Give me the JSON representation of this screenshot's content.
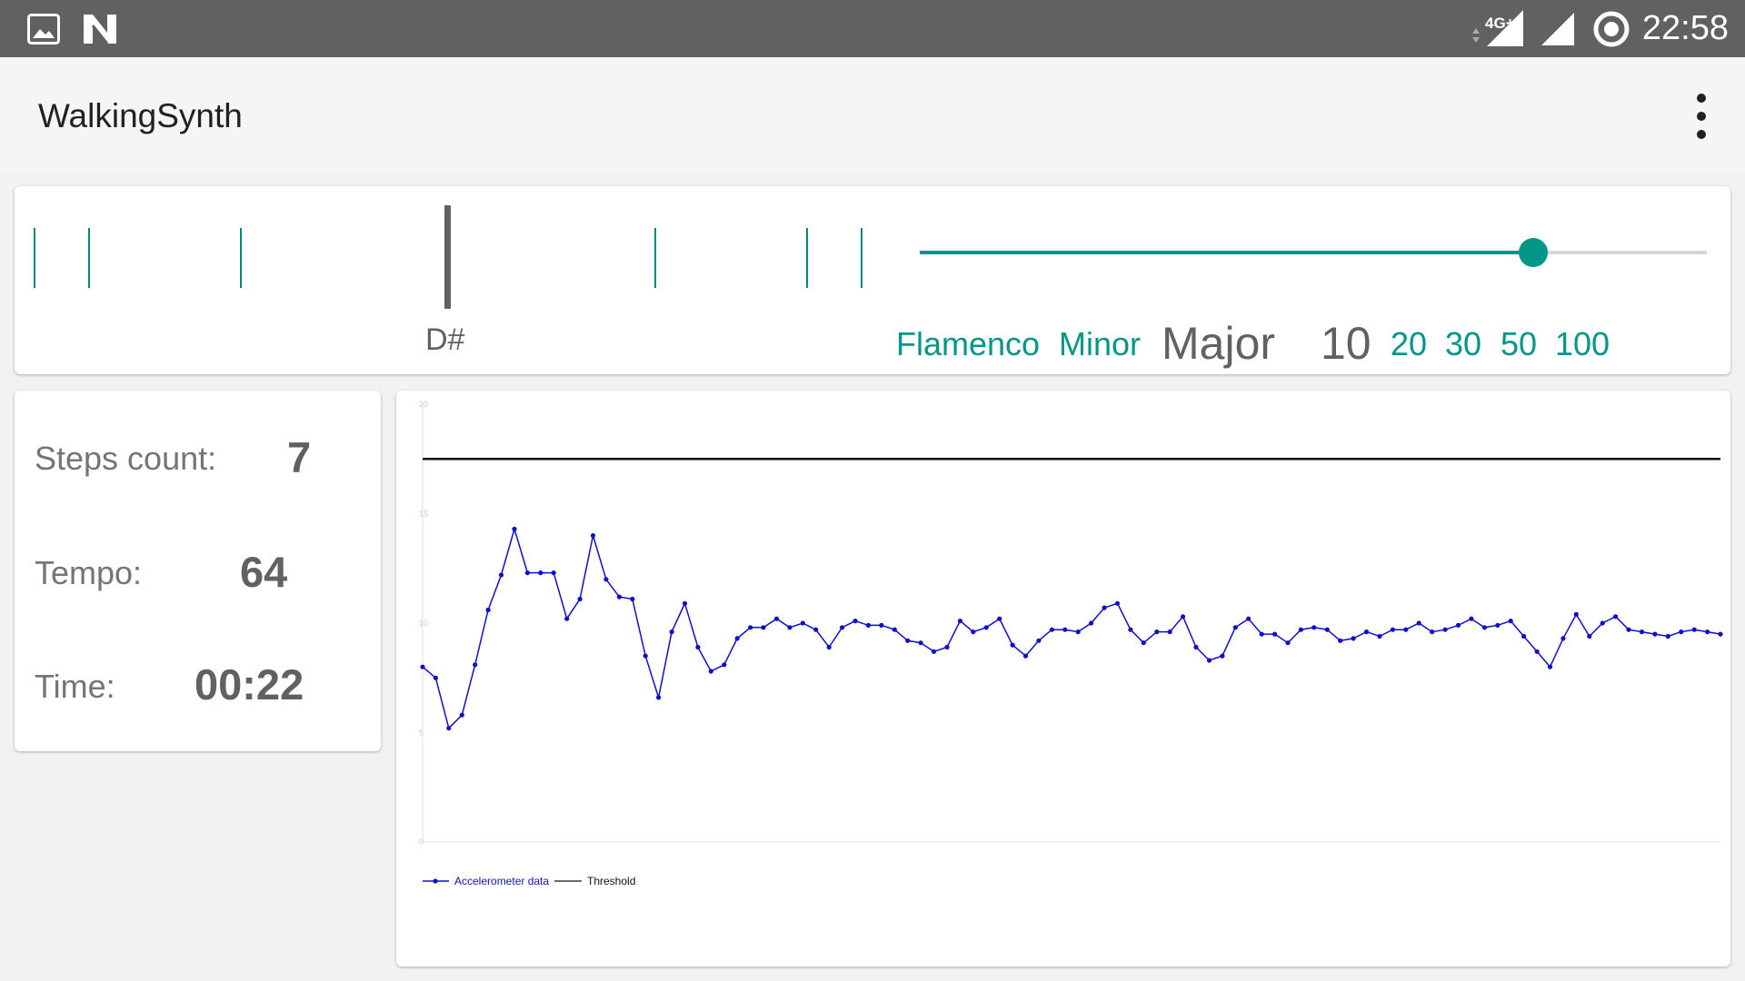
{
  "status_bar": {
    "time": "22:58",
    "network": "4G+",
    "icons": [
      "image-icon",
      "n-icon",
      "signal-4g-icon",
      "signal-icon",
      "sync-circle-icon"
    ]
  },
  "app_bar": {
    "title": "WalkingSynth",
    "menu_icon": "more-vert-icon"
  },
  "note_display": {
    "current_note": "D#"
  },
  "slider": {
    "value": 0.78
  },
  "scale_options": [
    {
      "label": "Flamenco",
      "selected": false
    },
    {
      "label": "Minor",
      "selected": false
    },
    {
      "label": "Major",
      "selected": true
    }
  ],
  "number_options": [
    {
      "label": "10",
      "selected": true
    },
    {
      "label": "20",
      "selected": false
    },
    {
      "label": "30",
      "selected": false
    },
    {
      "label": "50",
      "selected": false
    },
    {
      "label": "100",
      "selected": false
    }
  ],
  "stats": {
    "steps_label": "Steps count:",
    "steps_value": "7",
    "tempo_label": "Tempo:",
    "tempo_value": "64",
    "time_label": "Time:",
    "time_value": "00:22"
  },
  "colors": {
    "accent": "#009688",
    "series": "#1010c8",
    "threshold": "#111111"
  },
  "chart_data": {
    "type": "line",
    "ylim": [
      0,
      20
    ],
    "yticks": [
      "0",
      "5",
      "10",
      "15",
      "20"
    ],
    "grid": false,
    "legend_position": "bottom-left",
    "series": [
      {
        "name": "Accelerometer data",
        "values": [
          8.0,
          7.5,
          5.2,
          5.8,
          8.1,
          10.6,
          12.2,
          14.3,
          12.3,
          12.3,
          12.3,
          10.2,
          11.1,
          14.0,
          12.0,
          11.2,
          11.1,
          8.5,
          6.6,
          9.6,
          10.9,
          8.9,
          7.8,
          8.1,
          9.3,
          9.8,
          9.8,
          10.2,
          9.8,
          10.0,
          9.7,
          8.9,
          9.8,
          10.1,
          9.9,
          9.9,
          9.7,
          9.2,
          9.1,
          8.7,
          8.9,
          10.1,
          9.6,
          9.8,
          10.2,
          9.0,
          8.5,
          9.2,
          9.7,
          9.7,
          9.6,
          10.0,
          10.7,
          10.9,
          9.7,
          9.1,
          9.6,
          9.6,
          10.3,
          8.9,
          8.3,
          8.5,
          9.8,
          10.2,
          9.5,
          9.5,
          9.1,
          9.7,
          9.8,
          9.7,
          9.2,
          9.3,
          9.6,
          9.4,
          9.7,
          9.7,
          10.0,
          9.6,
          9.7,
          9.9,
          10.2,
          9.8,
          9.9,
          10.1,
          9.4,
          8.7,
          8.0,
          9.3,
          10.4,
          9.4,
          10.0,
          10.3,
          9.7,
          9.6,
          9.5,
          9.4,
          9.6,
          9.7,
          9.6,
          9.5
        ]
      },
      {
        "name": "Threshold",
        "values": [
          17.5,
          17.5
        ]
      }
    ]
  }
}
